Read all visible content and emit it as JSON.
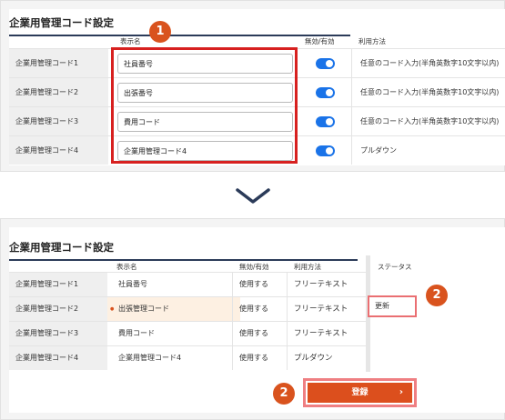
{
  "before": {
    "title": "企業用管理コード設定",
    "headers": {
      "display_name": "表示名",
      "enabled": "無効/有効",
      "usage": "利用方法"
    },
    "rows": [
      {
        "label": "企業用管理コード1",
        "value": "社員番号",
        "toggle_on": true,
        "usage": "任意のコード入力(半角英数字10文字以内)"
      },
      {
        "label": "企業用管理コード2",
        "value": "出張番号",
        "toggle_on": true,
        "usage": "任意のコード入力(半角英数字10文字以内)"
      },
      {
        "label": "企業用管理コード3",
        "value": "費用コード",
        "toggle_on": true,
        "usage": "任意のコード入力(半角英数字10文字以内)"
      },
      {
        "label": "企業用管理コード4",
        "value": "企業用管理コード4",
        "toggle_on": true,
        "usage": "プルダウン"
      }
    ],
    "step_badge": "1"
  },
  "after": {
    "title": "企業用管理コード設定",
    "headers": {
      "display_name": "表示名",
      "enabled": "無効/有効",
      "usage": "利用方法",
      "status": "ステータス"
    },
    "rows": [
      {
        "label": "企業用管理コード1",
        "name": "社員番号",
        "enabled": "使用する",
        "usage": "フリーテキスト",
        "status": ""
      },
      {
        "label": "企業用管理コード2",
        "name": "出張管理コード",
        "enabled": "使用する",
        "usage": "フリーテキスト",
        "status": "更新"
      },
      {
        "label": "企業用管理コード3",
        "name": "費用コード",
        "enabled": "使用する",
        "usage": "フリーテキスト",
        "status": ""
      },
      {
        "label": "企業用管理コード4",
        "name": "企業用管理コード4",
        "enabled": "使用する",
        "usage": "プルダウン",
        "status": ""
      }
    ],
    "step_badge_status": "2",
    "step_badge_button": "2",
    "submit_label": "登録",
    "submit_arrow": "›"
  },
  "colors": {
    "navy_rule": "#2b3b59",
    "highlight_red": "#d7201f",
    "badge_orange": "#d9531e",
    "toggle_blue": "#1a73e8",
    "submit_orange": "#dc4f1d"
  },
  "icons": {
    "transition": "chevron-down-icon"
  }
}
